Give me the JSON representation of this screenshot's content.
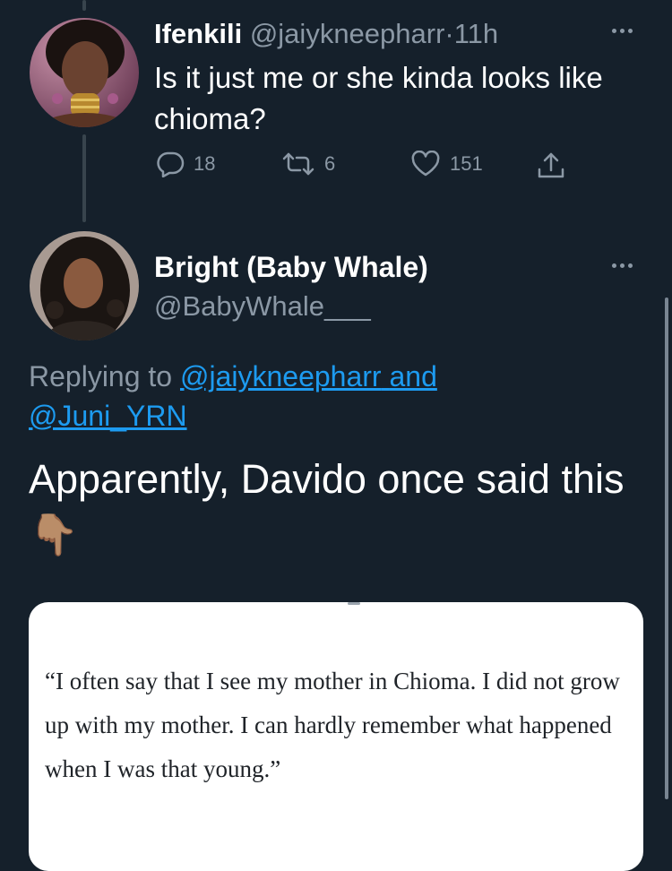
{
  "tweet1": {
    "display_name": "Ifenkili",
    "handle": "@jaiykneepharr",
    "separator": "·",
    "time": "11h",
    "text": "Is it just me or she kinda looks like chioma?",
    "reply_count": "18",
    "retweet_count": "6",
    "like_count": "151"
  },
  "tweet2": {
    "display_name": "Bright (Baby Whale)",
    "handle": "@BabyWhale___",
    "replying_prefix": "Replying to",
    "replying_user1": "@jaiykneepharr",
    "replying_and": "and",
    "replying_user2": "@Juni_YRN",
    "text": "Apparently, Davido once said this",
    "emoji": "👇🏽"
  },
  "quote_card": {
    "text": "“I often say that I see my mother in Chioma. I did not grow up with my mother. I can hardly remember what happened when I was that young.”"
  },
  "icons": {
    "more": "more-dots-icon",
    "reply": "reply-bubble-icon",
    "retweet": "retweet-icon",
    "like": "heart-icon",
    "share": "share-icon"
  },
  "colors": {
    "background": "#15202b",
    "muted_text": "#8b98a5",
    "link": "#1d9bf0",
    "thread_line": "#38444d"
  }
}
